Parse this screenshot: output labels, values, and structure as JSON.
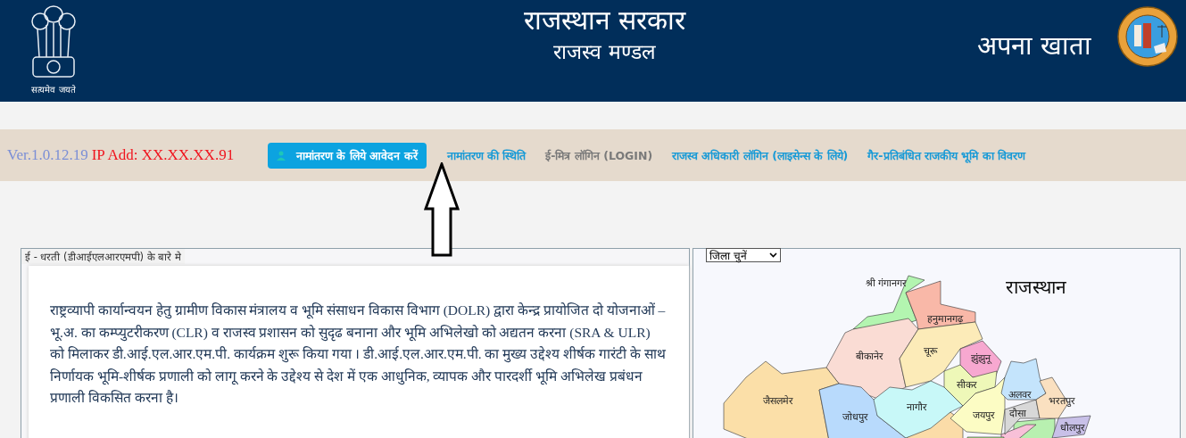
{
  "header": {
    "motto": "सत्यमेव जयते",
    "title": "राजस्थान सरकार",
    "subtitle": "राजस्व मण्डल",
    "app_name": "अपना खाता"
  },
  "nav": {
    "version": "Ver.1.0.12.19",
    "ip": "IP Add: XX.XX.XX.91",
    "links": [
      {
        "label": "नामांतरण के लिये आवेदन करें",
        "kind": "button"
      },
      {
        "label": "नामांतरण की स्थिति",
        "kind": "link"
      },
      {
        "label": "ई-मित्र लॉगिन (LOGIN)",
        "kind": "muted"
      },
      {
        "label": "राजस्व अधिकारी लॉगिन (लाइसेन्स के लिये)",
        "kind": "link"
      },
      {
        "label": "गैर-प्रतिबंधित राजकीय भूमि का विवरण",
        "kind": "link"
      }
    ]
  },
  "about": {
    "title": "ई - धरती (डीआईएलआरएमपी) के बारे मे",
    "paragraph": "राष्ट्रव्यापी कार्यान्वयन हेतु ग्रामीण विकास मंत्रालय व भूमि संसाधन विकास विभाग (DOLR) द्वारा केन्द्र प्रायोजित दो योजनाओं – भू.अ. का कम्प्युटरीकरण (CLR) व राजस्व प्रशासन को सुदृढ बनाना और भूमि अभिलेखो को अद्यतन करना (SRA & ULR) को मिलाकर डी.आई.एल.आर.एम.पी. कार्यक्रम शुरू किया गया । डी.आई.एल.आर.एम.पी. का मुख्य उद्देश्य शीर्षक गारंटी के साथ निर्णायक भूमि-शीर्षक प्रणाली को लागू करने के उद्देश्य से देश में एक आधुनिक, व्यापक और पारदर्शी भूमि अभिलेख प्रबंधन प्रणाली विकसित करना है।"
  },
  "map": {
    "select": {
      "value": "जिला चुनें"
    },
    "title": "राजस्थान",
    "districts": [
      {
        "name": "श्री गंगानगर",
        "color": "#b3f5b0"
      },
      {
        "name": "हनुमानगढ़",
        "color": "#f9b8a8"
      },
      {
        "name": "बीकानेर",
        "color": "#fadcd4"
      },
      {
        "name": "चूरू",
        "color": "#fcebb8"
      },
      {
        "name": "झुंझुनू",
        "color": "#f7a8d0"
      },
      {
        "name": "सीकर",
        "color": "#eef8b8"
      },
      {
        "name": "जैसलमेर",
        "color": "#fbdfa8"
      },
      {
        "name": "जोधपुर",
        "color": "#b8dafc"
      },
      {
        "name": "नागौर",
        "color": "#c8f8f8"
      },
      {
        "name": "जयपुर",
        "color": "#fcfcc4"
      },
      {
        "name": "दौसा",
        "color": "#d8d8d8"
      },
      {
        "name": "अलवर",
        "color": "#c4e4fc"
      },
      {
        "name": "भरतपुर",
        "color": "#fae0c0"
      },
      {
        "name": "धौलपुर",
        "color": "#c8c0e8"
      }
    ]
  }
}
